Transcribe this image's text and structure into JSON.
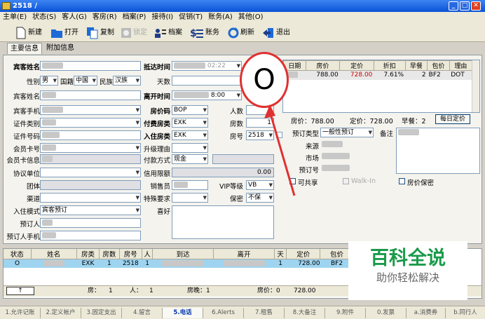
{
  "window": {
    "title": "2518 /",
    "min": "_",
    "max": "□",
    "close": "✕"
  },
  "menu": [
    "主单(E)",
    "状态(S)",
    "客人(G)",
    "客房(R)",
    "档案(P)",
    "接待(I)",
    "促销(T)",
    "账务(A)",
    "其他(O)"
  ],
  "toolbar": {
    "new": "新建",
    "open": "打开",
    "copy": "复制",
    "lock": "锁定",
    "profile": "档案",
    "account": "账务",
    "refresh": "刷新",
    "exit": "退出"
  },
  "tabs": [
    "主要信息",
    "附加信息"
  ],
  "left": {
    "name": "宾客姓名",
    "gender": "性别",
    "gender_val": "男",
    "nationality": "国籍",
    "nationality_val": "中国",
    "ethnic": "民族",
    "ethnic_val": "汉族",
    "name2": "宾客姓名",
    "phone": "宾客手机",
    "idtype": "证件类别",
    "idno": "证件号码",
    "member": "会员卡号",
    "memberinfo": "会员卡信息",
    "company": "协议单位",
    "group": "团体",
    "channel": "渠道",
    "mode": "入住模式",
    "mode_val": "宾客预订",
    "booker": "预订人",
    "booker_phone": "预订人手机"
  },
  "mid": {
    "arrive": "抵达时间",
    "arrive_time": "02:22",
    "days": "天数",
    "depart": "离开时间",
    "depart_time": "8:00",
    "ratecode": "房价码",
    "ratecode_val": "BOP",
    "persons": "人数",
    "persons_val": "1",
    "roomtype": "付费房类",
    "roomtype_val": "EXK",
    "rooms": "房数",
    "rooms_val": "1",
    "checkin_type": "入住房类",
    "checkin_type_val": "EXK",
    "roomno": "房号",
    "roomno_val": "2518",
    "upgrade": "升级理由",
    "pay": "付款方式",
    "pay_val": "现金",
    "credit": "信用限额",
    "credit_val": "0.00",
    "seller": "销售员",
    "vip": "VIP等级",
    "vip_val": "VB",
    "special": "特殊要求",
    "secret": "保密",
    "secret_val": "不保",
    "pref": "喜好"
  },
  "rates": {
    "headers": [
      "日期",
      "房价",
      "定价",
      "折扣",
      "早餐",
      "包价",
      "理由"
    ],
    "row": {
      "price": "788.00",
      "fixed": "728.00",
      "discount": "7.61%",
      "breakfast": "2",
      "pkg": "BF2",
      "reason": "DOT"
    },
    "summary_price": "房价：788.00",
    "summary_fixed": "定价：728.00",
    "summary_bf": "早餐：2",
    "daily_btn": "每日定价"
  },
  "booking": {
    "type": "预订类型",
    "type_val": "一般性预订",
    "note": "备注",
    "source": "来源",
    "market": "市场",
    "bookno": "预订号",
    "shared": "可共享",
    "walkin": "Walk-In",
    "secret_rate": "房价保密"
  },
  "guest": {
    "headers": [
      "状态",
      "姓名",
      "房类",
      "房数",
      "房号",
      "人",
      "到达",
      "离开",
      "天",
      "定价",
      "包价"
    ],
    "row": {
      "status": "O",
      "type": "EXK",
      "rooms": "1",
      "roomno": "2518",
      "persons": "1",
      "days": "1",
      "fixed": "728.00",
      "pkg": "BF2"
    },
    "footer": {
      "rooms": "房：",
      "rooms_val": "1",
      "persons": "人：",
      "persons_val": "1",
      "nights": "房晚：1",
      "rate": "房价：0",
      "rate_val": "728.00"
    }
  },
  "fkeys": [
    "1.允许记账",
    "2.定义帐户",
    "3.固定支出",
    "4.留言",
    "5.电话",
    "6.Alerts",
    "7.租售",
    "8.大备注",
    "9.附件",
    "0.发票",
    "a.消费券",
    "b.同行人"
  ],
  "callout": "O",
  "watermark": {
    "title": "百科全说",
    "sub": "助你轻松解决"
  },
  "colors": {
    "accent": "#0a52d6",
    "callout": "#e03030",
    "highlight_row": "#9ed4f0",
    "fixed_price": "#cc0000",
    "watermark_green": "#1a9a4a"
  }
}
